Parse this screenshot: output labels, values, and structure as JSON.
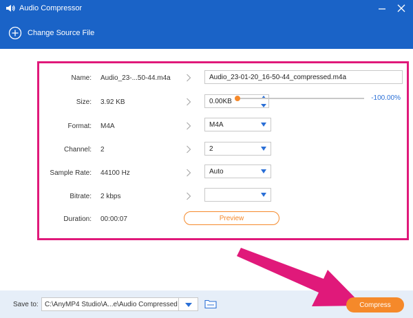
{
  "window": {
    "title": "Audio Compressor"
  },
  "toolbar": {
    "change_source_label": "Change Source File"
  },
  "form": {
    "name": {
      "label": "Name:",
      "source": "Audio_23-...50-44.m4a",
      "target": "Audio_23-01-20_16-50-44_compressed.m4a"
    },
    "size": {
      "label": "Size:",
      "source": "3.92 KB",
      "target": "0.00KB",
      "percent": "-100.00%",
      "slider_fraction": 0.0
    },
    "format": {
      "label": "Format:",
      "source": "M4A",
      "target": "M4A"
    },
    "channel": {
      "label": "Channel:",
      "source": "2",
      "target": "2"
    },
    "sample_rate": {
      "label": "Sample Rate:",
      "source": "44100 Hz",
      "target": "Auto"
    },
    "bitrate": {
      "label": "Bitrate:",
      "source": "2 kbps",
      "target": ""
    },
    "duration": {
      "label": "Duration:",
      "source": "00:00:07"
    }
  },
  "preview_label": "Preview",
  "bottom": {
    "save_to_label": "Save to:",
    "save_path": "C:\\AnyMP4 Studio\\A...e\\Audio Compressed",
    "compress_label": "Compress"
  },
  "colors": {
    "title_bar": "#1a63c7",
    "highlight_border": "#e0197a",
    "accent_orange": "#f5892a",
    "link_blue": "#2a6fd6",
    "annotation_arrow": "#e0197a"
  },
  "icons": {
    "app": "speaker-icon",
    "minimize": "minimize-icon",
    "close": "close-icon",
    "add_source": "plus-circle-icon",
    "folder": "folder-icon",
    "chevron": "chevron-right-icon"
  }
}
